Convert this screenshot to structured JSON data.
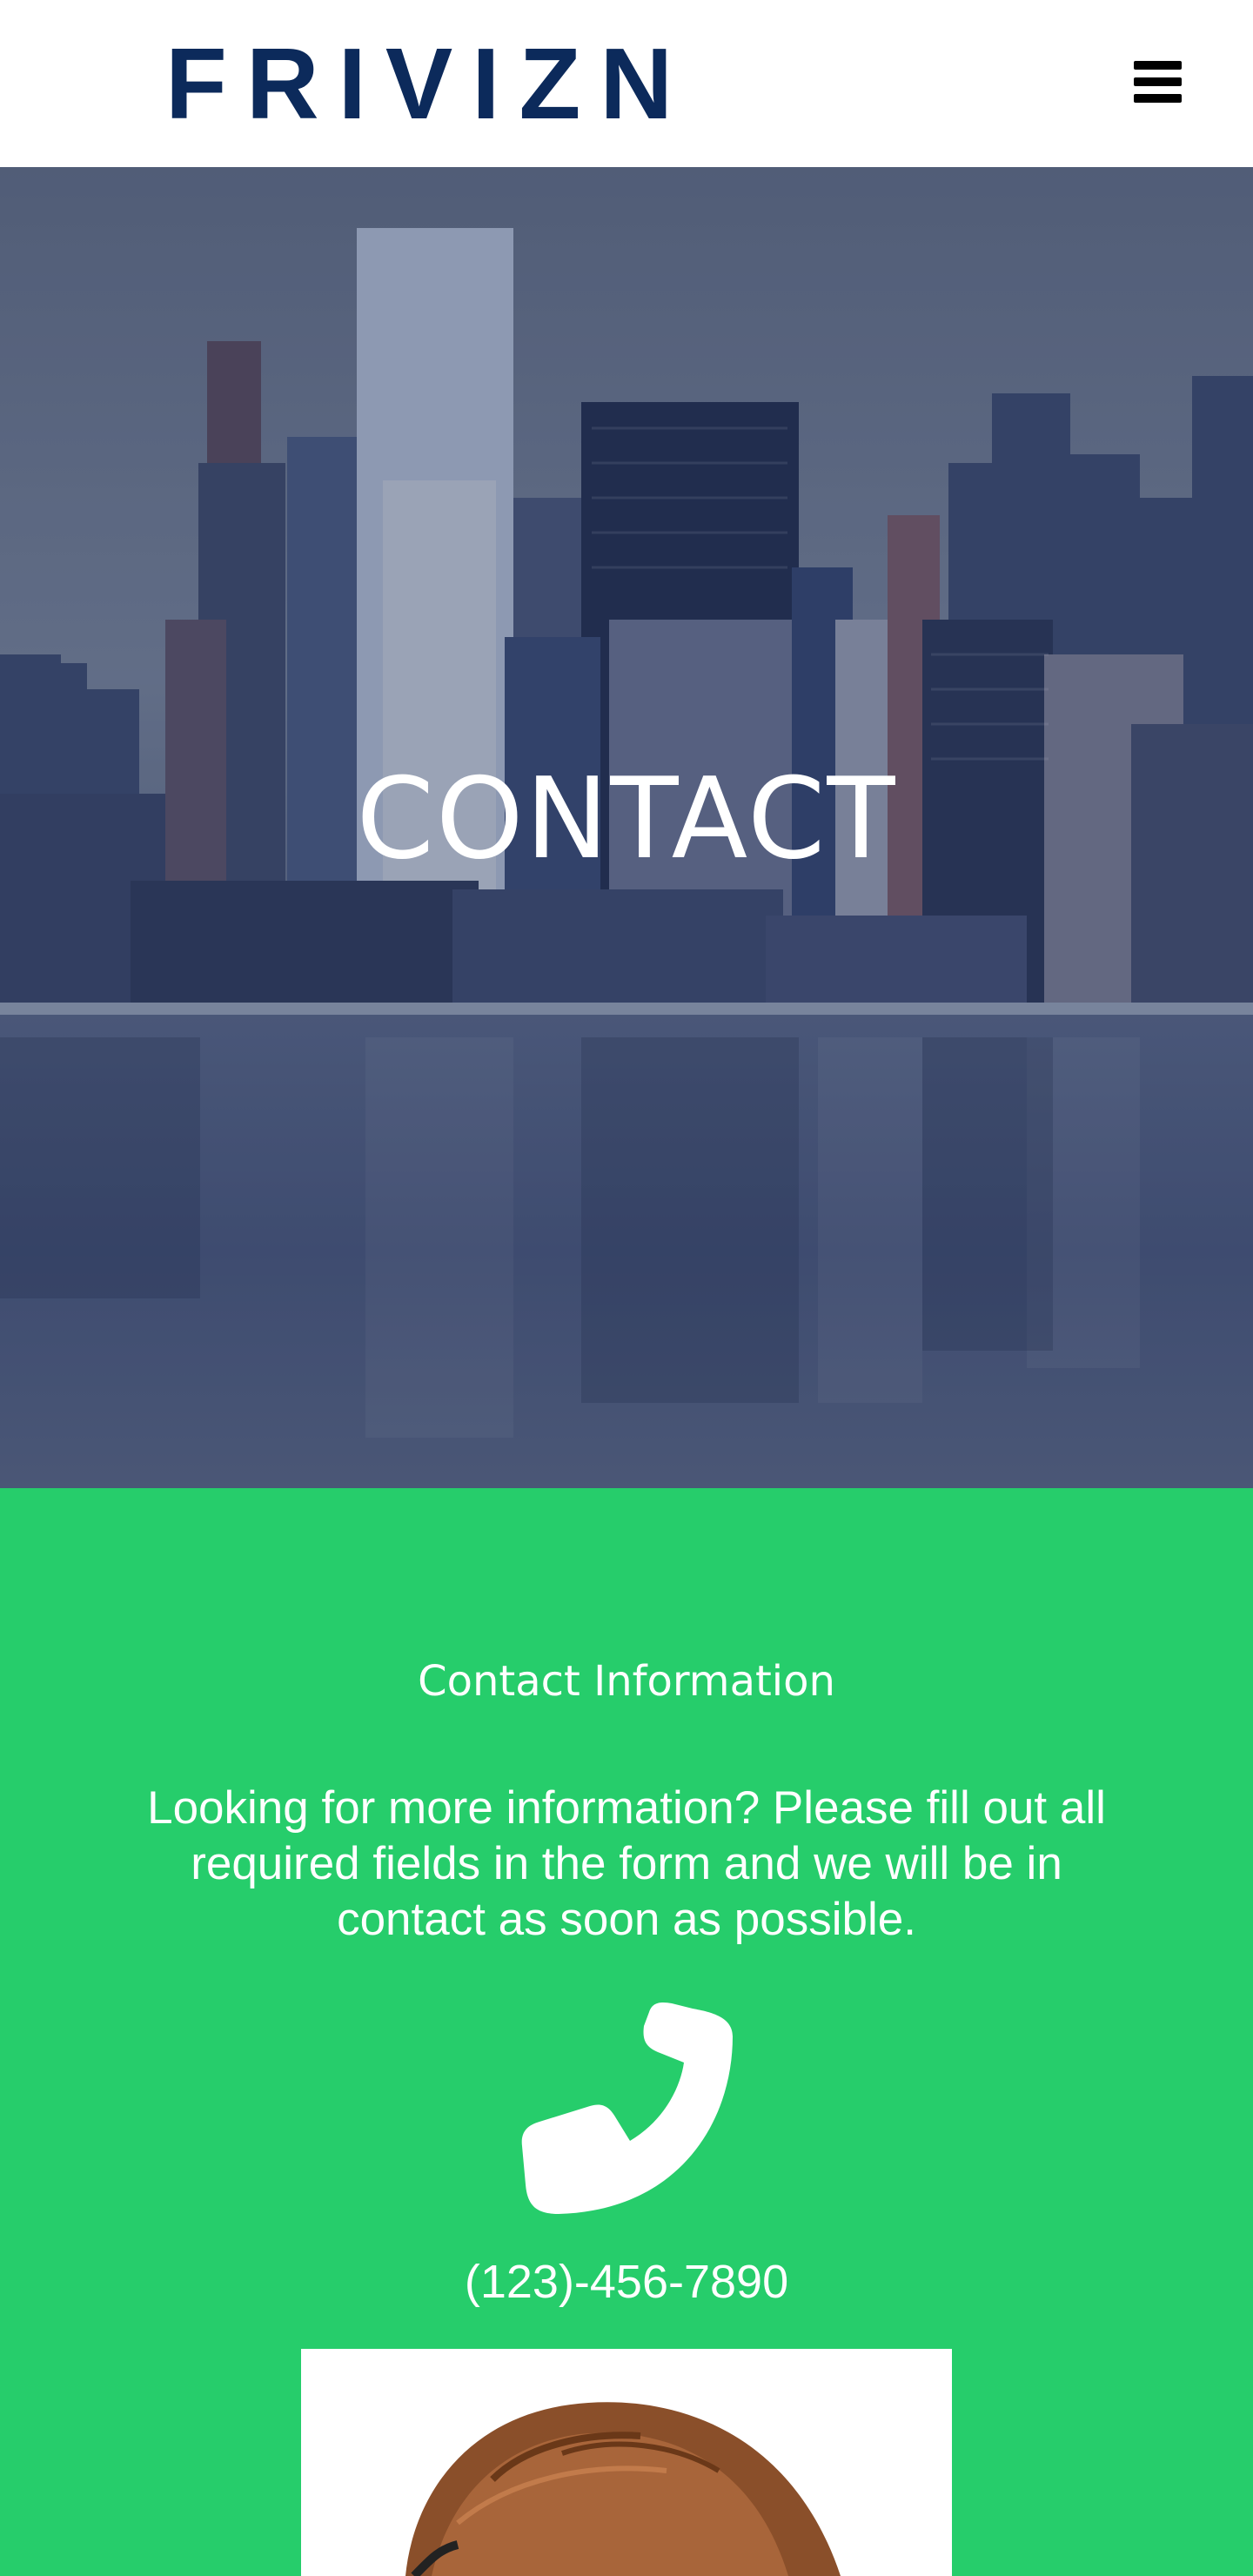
{
  "header": {
    "logo_text": "FRIVIZN",
    "menu_icon": "hamburger-menu-icon"
  },
  "hero": {
    "title": "CONTACT"
  },
  "contact": {
    "heading": "Contact Information",
    "text": "Looking for more information? Please fill out all required fields in the form and we will be in contact as soon as possible.",
    "phone_icon": "phone-icon",
    "phone_number": "(123)-456-7890"
  },
  "colors": {
    "logo": "#0c2a5b",
    "contact_background": "#26cd6b",
    "text_light": "#ffffff"
  }
}
